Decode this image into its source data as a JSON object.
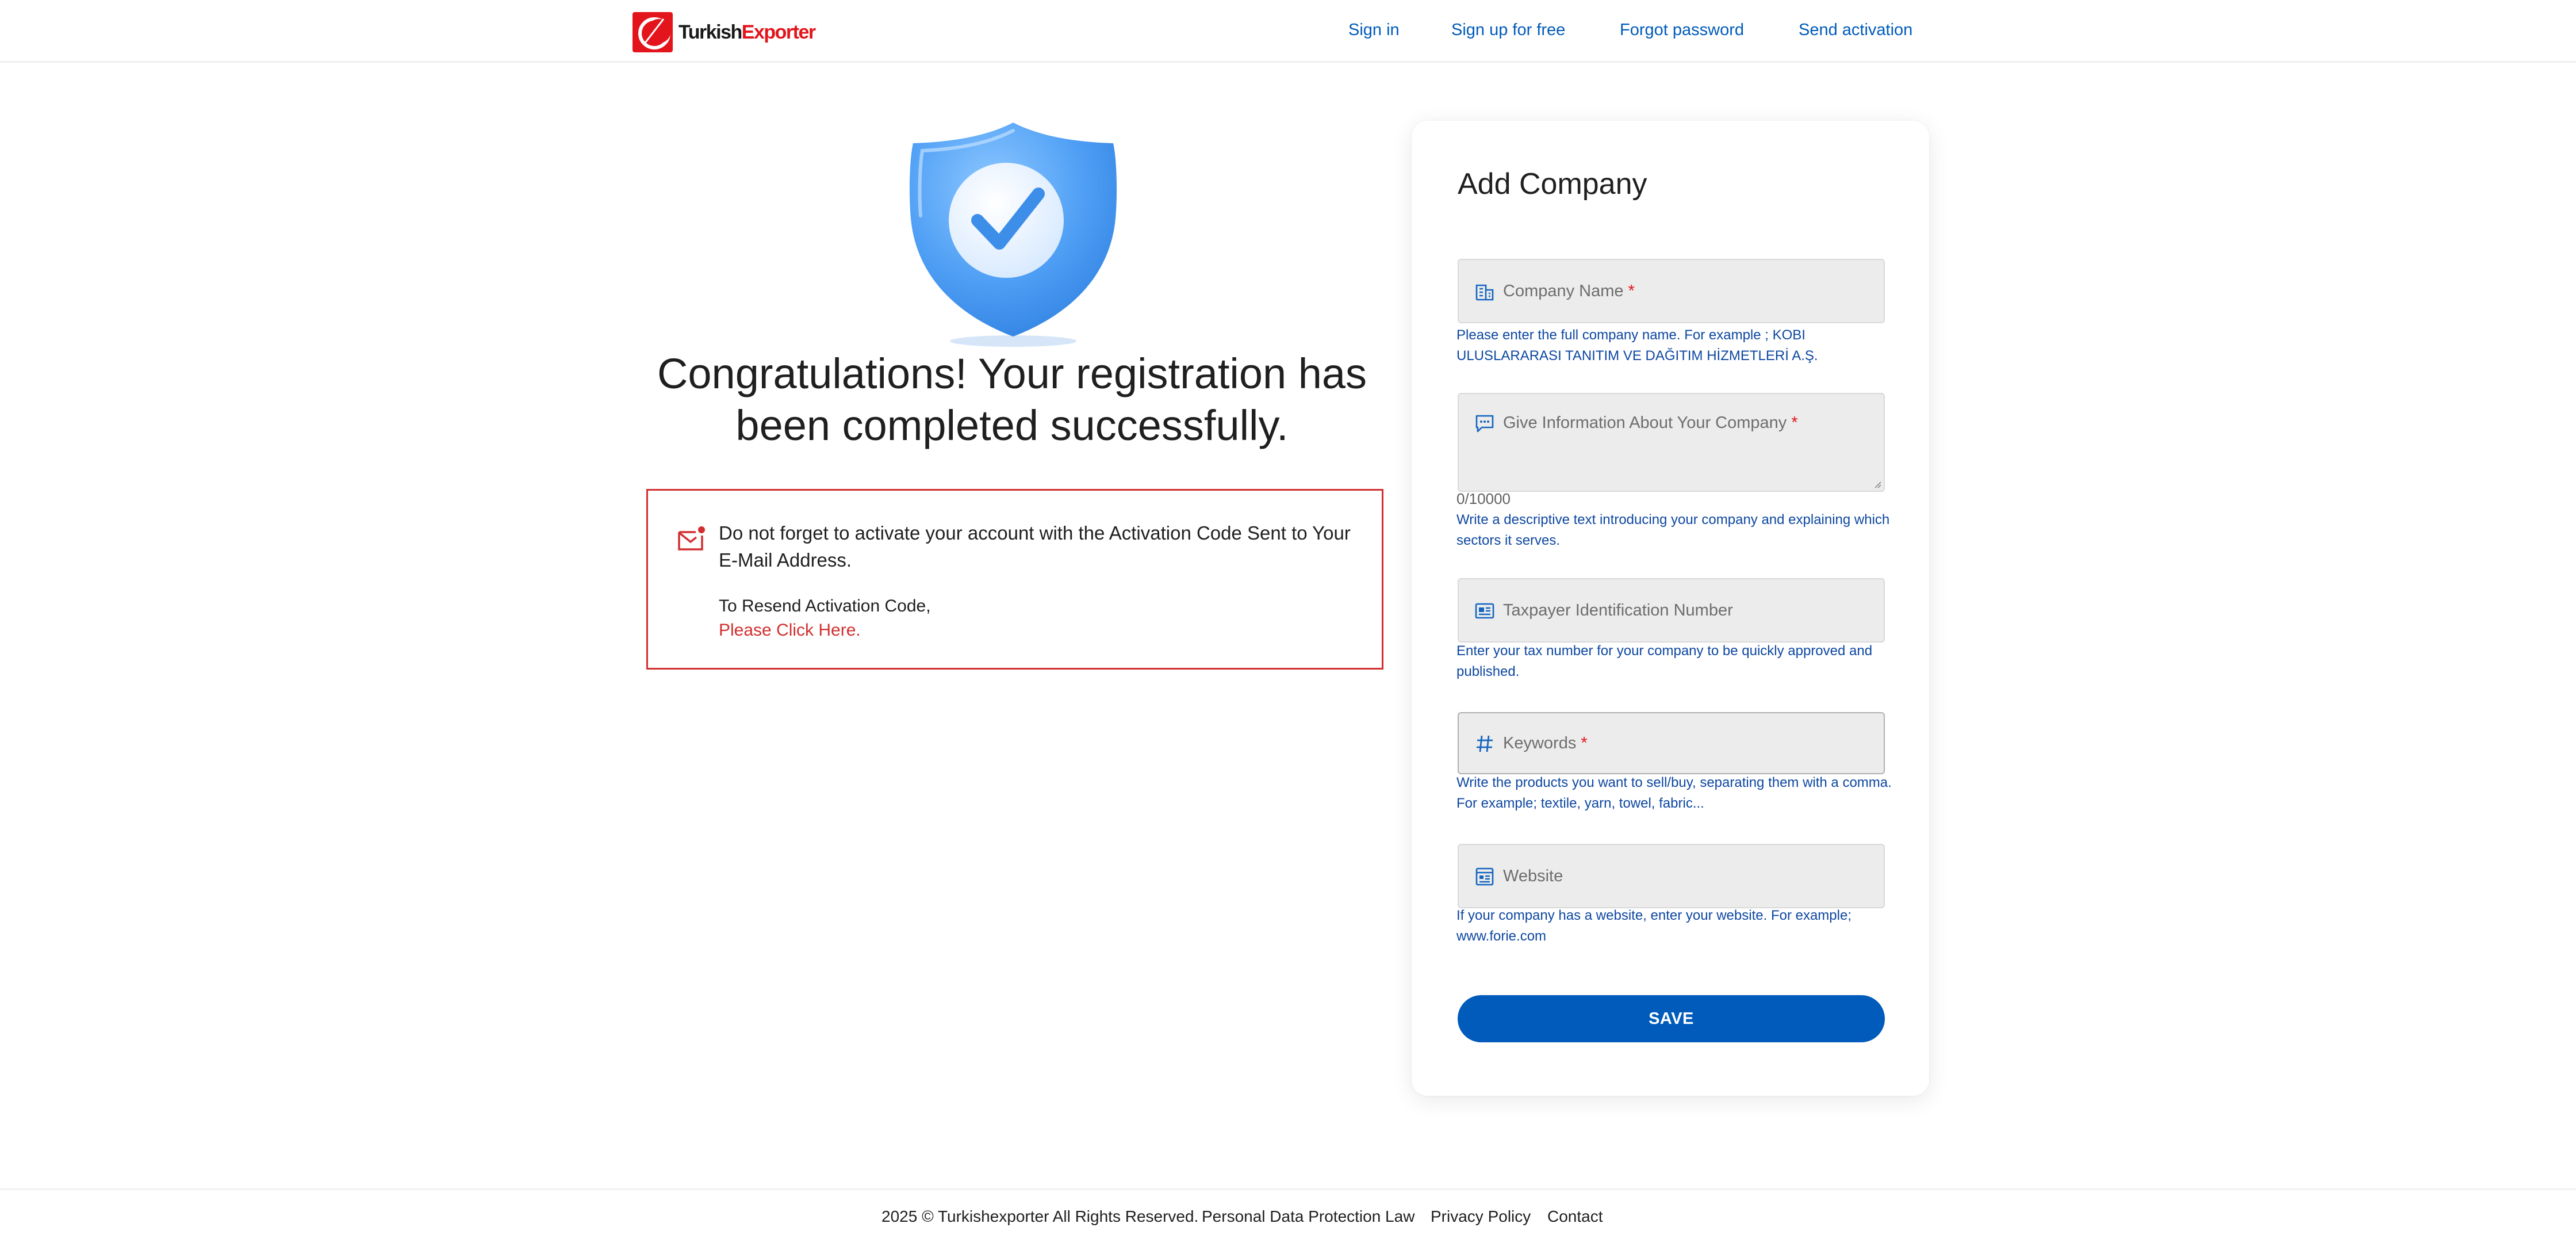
{
  "header": {
    "logo_text_dark": "Turkish",
    "logo_text_red": "Exporter",
    "nav": {
      "sign_in": "Sign in",
      "sign_up": "Sign up for free",
      "forgot_password": "Forgot password",
      "send_activation": "Send activation"
    }
  },
  "success": {
    "title": "Congratulations! Your registration has been completed successfully.",
    "notice_message": "Do not forget to activate your account with the Activation Code Sent to Your E-Mail Address.",
    "resend_text": "To Resend Activation Code,",
    "resend_link": "Please Click Here."
  },
  "form": {
    "title": "Add Company",
    "company_name": {
      "label": "Company Name",
      "required_mark": "*",
      "icon": "building-icon",
      "help": "Please enter the full company name. For example ; KOBI ULUSLARARASI TANITIM VE DAĞITIM HİZMETLERİ A.Ş."
    },
    "about": {
      "label": "Give Information About Your Company",
      "required_mark": "*",
      "icon": "chat-icon",
      "counter": "0/10000",
      "help": "Write a descriptive text introducing your company and explaining which sectors it serves."
    },
    "taxpayer": {
      "label": "Taxpayer Identification Number",
      "icon": "id-card-icon",
      "help": "Enter your tax number for your company to be quickly approved and published."
    },
    "keywords": {
      "label": "Keywords",
      "required_mark": "*",
      "icon": "hashtag-icon",
      "help": "Write the products you want to sell/buy, separating them with a comma. For example; textile, yarn, towel, fabric..."
    },
    "website": {
      "label": "Website",
      "icon": "web-icon",
      "help": "If your company has a website, enter your website. For example; www.forie.com"
    },
    "save_label": "SAVE"
  },
  "footer": {
    "copyright": "2025 © Turkishexporter All Rights Reserved.",
    "kvkk": "Personal Data Protection Law",
    "privacy": "Privacy Policy",
    "contact": "Contact"
  },
  "colors": {
    "brand_red": "#e3141b",
    "brand_blue": "#005bbb",
    "help_blue": "#0d47a1"
  }
}
